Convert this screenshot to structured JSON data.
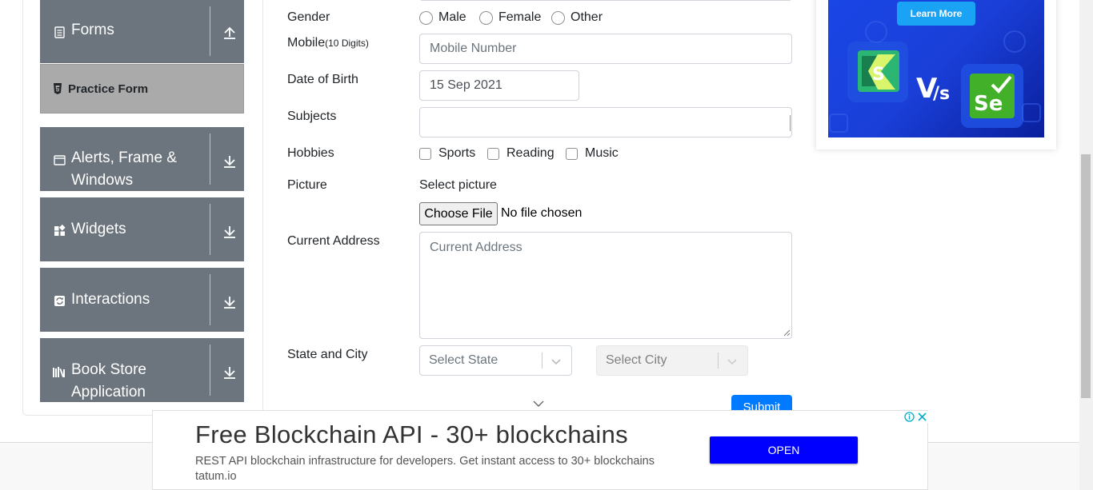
{
  "sidebar": {
    "groups": [
      {
        "title": "Forms",
        "icon": "document-icon",
        "arrow": "arrow-up-icon"
      },
      {
        "title": "Alerts, Frame & Windows",
        "icon": "window-icon",
        "arrow": "arrow-down-icon"
      },
      {
        "title": "Widgets",
        "icon": "widgets-icon",
        "arrow": "arrow-down-icon"
      },
      {
        "title": "Interactions",
        "icon": "refresh-icon",
        "arrow": "arrow-down-icon"
      },
      {
        "title": "Book Store Application",
        "icon": "books-icon",
        "arrow": "arrow-down-icon"
      }
    ],
    "active_item": {
      "label": "Practice Form",
      "icon": "html5-icon"
    }
  },
  "form": {
    "gender": {
      "label": "Gender",
      "options": [
        "Male",
        "Female",
        "Other"
      ]
    },
    "mobile": {
      "label": "Mobile",
      "label_hint": "(10 Digits)",
      "placeholder": "Mobile Number",
      "value": ""
    },
    "dob": {
      "label": "Date of Birth",
      "value": "15 Sep 2021"
    },
    "subjects": {
      "label": "Subjects",
      "value": ""
    },
    "hobbies": {
      "label": "Hobbies",
      "options": [
        "Sports",
        "Reading",
        "Music"
      ]
    },
    "picture": {
      "label": "Picture",
      "caption": "Select picture",
      "button": "Choose File",
      "status": "No file chosen"
    },
    "address": {
      "label": "Current Address",
      "placeholder": "Current Address"
    },
    "state_city": {
      "label": "State and City",
      "state_placeholder": "Select State",
      "city_placeholder": "Select City"
    },
    "submit": "Submit"
  },
  "side_ad": {
    "button": "Learn More"
  },
  "bottom_ad": {
    "title": "Free Blockchain API - 30+ blockchains",
    "description": "REST API blockchain infrastructure for developers. Get instant access to 30+ blockchains tatum.io",
    "button": "OPEN"
  },
  "colors": {
    "sidebar_group": "#6c757d",
    "sidebar_active": "#aaaaaa",
    "primary": "#007bff",
    "ad_open": "#0000ff"
  }
}
